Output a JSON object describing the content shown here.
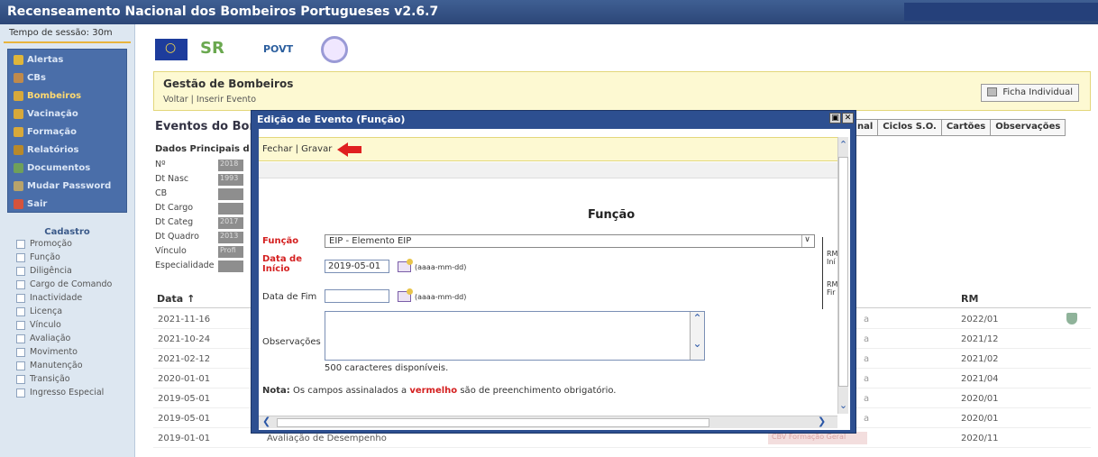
{
  "app": {
    "title": "Recenseamento Nacional dos Bombeiros Portugueses v2.6.7"
  },
  "sidebar": {
    "session": "Tempo de sessão: 30m",
    "menu": [
      {
        "label": "Alertas",
        "icon": "alert-icon",
        "color": "#e0b63a"
      },
      {
        "label": "CBs",
        "icon": "building-icon",
        "color": "#c08a4b"
      },
      {
        "label": "Bombeiros",
        "icon": "firefighter-icon",
        "color": "#d8a93a"
      },
      {
        "label": "Vacinação",
        "icon": "syringe-icon",
        "color": "#d8a93a"
      },
      {
        "label": "Formação",
        "icon": "training-icon",
        "color": "#d8a93a"
      },
      {
        "label": "Relatórios",
        "icon": "report-icon",
        "color": "#b8892a"
      },
      {
        "label": "Documentos",
        "icon": "document-icon",
        "color": "#6fa05a"
      },
      {
        "label": "Mudar Password",
        "icon": "key-icon",
        "color": "#b8a36a"
      },
      {
        "label": "Sair",
        "icon": "exit-icon",
        "color": "#d5533c"
      }
    ],
    "cadastro_title": "Cadastro",
    "cadastro": [
      "Promoção",
      "Função",
      "Diligência",
      "Cargo de Comando",
      "Inactividade",
      "Licença",
      "Vínculo",
      "Avaliação",
      "Movimento",
      "Manutenção",
      "Transição",
      "Ingresso Especial"
    ]
  },
  "logos": {
    "povt": "POVT"
  },
  "gestao": {
    "title": "Gestão de Bombeiros",
    "links": "Voltar | Inserir Evento",
    "ficha_button": "Ficha Individual"
  },
  "eventos": {
    "title": "Eventos do Bom",
    "tabs": [
      "nal",
      "Ciclos S.O.",
      "Cartões",
      "Observações"
    ],
    "dados_title": "Dados Principais d",
    "fields": [
      {
        "label": "Nº",
        "value": "2018"
      },
      {
        "label": "Dt Nasc",
        "value": "1993"
      },
      {
        "label": "CB",
        "value": ""
      },
      {
        "label": "Dt Cargo",
        "value": ""
      },
      {
        "label": "Dt Categ",
        "value": "2017"
      },
      {
        "label": "Dt Quadro",
        "value": "2013"
      },
      {
        "label": "Vínculo",
        "value": "Profi"
      },
      {
        "label": "Especialidade",
        "value": ""
      }
    ],
    "table_head": {
      "data": "Data ↑",
      "rm": "RM"
    },
    "rows": [
      {
        "date": "2021-11-16",
        "a": "a",
        "rm": "2022/01",
        "desc": "",
        "pill": ""
      },
      {
        "date": "2021-10-24",
        "a": "a",
        "rm": "2021/12",
        "desc": "",
        "pill": ""
      },
      {
        "date": "2021-02-12",
        "a": "a",
        "rm": "2021/02",
        "desc": "",
        "pill": ""
      },
      {
        "date": "2020-01-01",
        "a": "a",
        "rm": "2021/04",
        "desc": "",
        "pill": ""
      },
      {
        "date": "2019-05-01",
        "a": "a",
        "rm": "2020/01",
        "desc": "",
        "pill": ""
      },
      {
        "date": "2019-05-01",
        "a": "a",
        "rm": "2020/01",
        "desc": "",
        "pill": ""
      },
      {
        "date": "2019-01-01",
        "a": "",
        "rm": "2020/11",
        "desc": "Avaliação de Desempenho",
        "pill": "CBV Formação Geral"
      }
    ]
  },
  "dialog": {
    "title": "Edição de Evento (Função)",
    "toolbar": "Fechar | Gravar",
    "form_title": "Função",
    "funcao_label": "Função",
    "funcao_value": "EIP - Elemento EIP",
    "data_inicio_label": "Data de Início",
    "data_inicio_value": "2019-05-01",
    "date_hint": "(aaaa-mm-dd)",
    "data_fim_label": "Data de Fim",
    "data_fim_value": "",
    "observacoes_label": "Observações",
    "chars_left": "500 caracteres disponíveis.",
    "nota_prefix": "Nota:",
    "nota_text1": " Os campos assinalados a ",
    "nota_red": "vermelho",
    "nota_text2": " são de preenchimento obrigatório.",
    "side1": "RM Iní",
    "side2": "RM Fir"
  }
}
